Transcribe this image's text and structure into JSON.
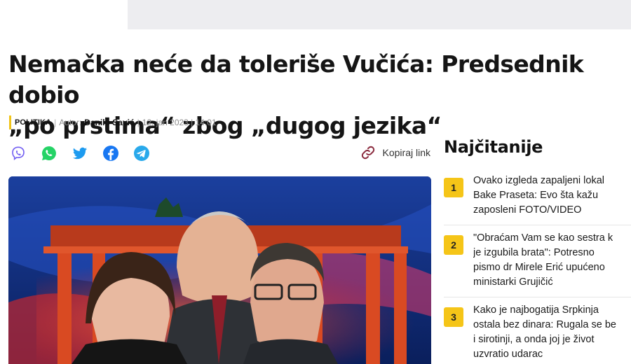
{
  "article": {
    "headline_line1": "Nemačka neće da toleriše Vučića: Predsednik dobio",
    "headline_line2": "„po prstima“ zbog „dugog jezika“",
    "category": "POLITIKA",
    "author_prefix": "Autor:",
    "author": "Danilo Savić",
    "date": "12. jan 2023 | 14:01",
    "copy_link_label": "Kopiraj link"
  },
  "share": {
    "icons": [
      "viber-icon",
      "whatsapp-icon",
      "twitter-icon",
      "facebook-icon",
      "telegram-icon"
    ],
    "colors": {
      "viber": "#7360f2",
      "whatsapp": "#25d366",
      "twitter": "#1d9bf0",
      "facebook": "#1877f2",
      "telegram": "#29a9eb"
    }
  },
  "sidebar": {
    "title": "Najčitanije",
    "items": [
      {
        "number": "1",
        "lines": [
          "Ovako izgleda zapaljeni lokal",
          "Bake Praseta: Evo šta kažu",
          "zaposleni FOTO/VIDEO"
        ]
      },
      {
        "number": "2",
        "lines": [
          "\"Obraćam Vam se kao sestra k",
          "je izgubila brata\": Potresno",
          "pismo dr Mirele Erić upućeno",
          "ministarki Grujičić"
        ]
      },
      {
        "number": "3",
        "lines": [
          "Kako je najbogatija Srpkinja",
          "ostala bez dinara: Rugala se be",
          "i sirotinji, a onda joj je život",
          "uzvratio udarac"
        ]
      }
    ]
  },
  "colors": {
    "accent": "#f5c518",
    "category_bar": "#f0c419"
  }
}
